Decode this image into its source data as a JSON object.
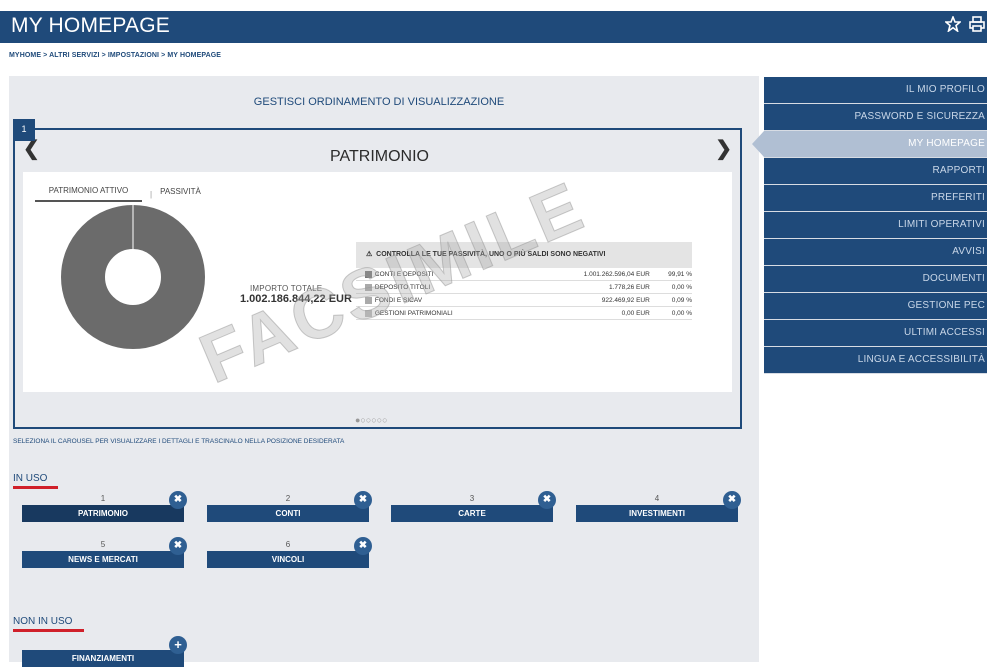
{
  "header": {
    "title": "MY HOMEPAGE",
    "icons": [
      "star-icon",
      "print-icon"
    ]
  },
  "breadcrumb": "MYHOME > ALTRI SERVIZI > IMPOSTAZIONI > MY HOMEPAGE",
  "main": {
    "heading": "GESTISCI ORDINAMENTO DI VISUALIZZAZIONE",
    "carousel_index": "1",
    "carousel_title": "PATRIMONIO",
    "tabs": [
      "PATRIMONIO ATTIVO",
      "PASSIVITÀ"
    ],
    "tab_sep": "|",
    "importo_label": "IMPORTO TOTALE",
    "importo_value": "1.002.186.844,22 EUR",
    "watermark": "FACSIMILE",
    "warning": "CONTROLLA LE TUE PASSIVITÀ, UNO O PIÙ SALDI SONO NEGATIVI",
    "rows": [
      {
        "label": "CONTI E DEPOSITI",
        "amount": "1.001.262.596,04 EUR",
        "pct": "99,91 %"
      },
      {
        "label": "DEPOSITO TITOLI",
        "amount": "1.778,26 EUR",
        "pct": "0,00 %"
      },
      {
        "label": "FONDI E SICAV",
        "amount": "922.469,92 EUR",
        "pct": "0,09 %"
      },
      {
        "label": "GESTIONI PATRIMONIALI",
        "amount": "0,00 EUR",
        "pct": "0,00 %"
      }
    ],
    "dots": "●○○○○○",
    "hint": "SELEZIONA IL CAROUSEL PER VISUALIZZARE I DETTAGLI E TRASCINALO NELLA POSIZIONE DESIDERATA",
    "in_uso_title": "IN USO",
    "non_in_uso_title": "NON IN USO",
    "in_uso": [
      {
        "num": "1",
        "label": "PATRIMONIO"
      },
      {
        "num": "2",
        "label": "CONTI"
      },
      {
        "num": "3",
        "label": "CARTE"
      },
      {
        "num": "4",
        "label": "INVESTIMENTI"
      },
      {
        "num": "5",
        "label": "NEWS E MERCATI"
      },
      {
        "num": "6",
        "label": "VINCOLI"
      }
    ],
    "non_in_uso": [
      {
        "label": "FINANZIAMENTI"
      }
    ],
    "remove_glyph": "✖",
    "add_glyph": "+"
  },
  "sidebar": {
    "items": [
      "IL MIO PROFILO",
      "PASSWORD E SICUREZZA",
      "MY HOMEPAGE",
      "RAPPORTI",
      "PREFERITI",
      "LIMITI OPERATIVI",
      "AVVISI",
      "DOCUMENTI",
      "GESTIONE PEC",
      "ULTIMI ACCESSI",
      "LINGUA E ACCESSIBILITÀ"
    ],
    "active": "MY HOMEPAGE"
  },
  "colors": {
    "primary": "#1f4a7a",
    "accent_underline": "#d0202a",
    "active_sidebar": "#b0bfd3"
  }
}
